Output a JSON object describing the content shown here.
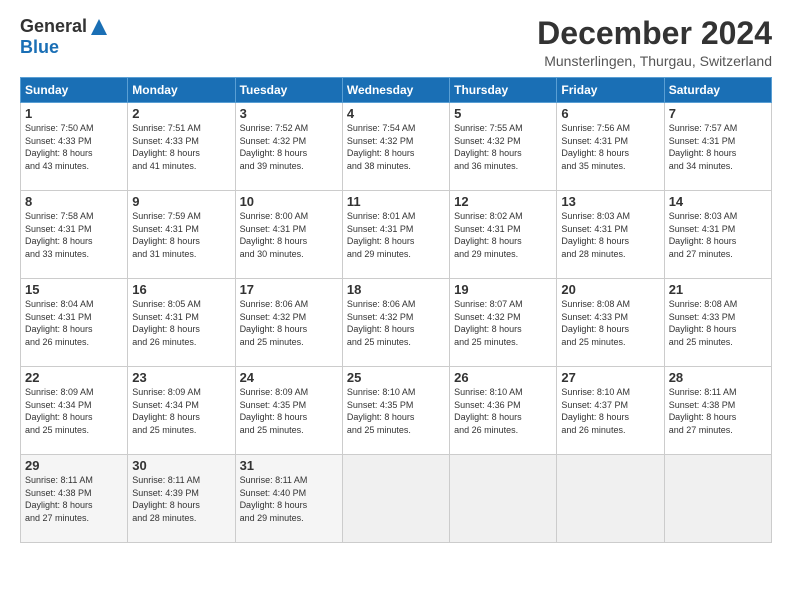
{
  "header": {
    "logo_general": "General",
    "logo_blue": "Blue",
    "month_title": "December 2024",
    "subtitle": "Munsterlingen, Thurgau, Switzerland"
  },
  "days_of_week": [
    "Sunday",
    "Monday",
    "Tuesday",
    "Wednesday",
    "Thursday",
    "Friday",
    "Saturday"
  ],
  "weeks": [
    [
      {
        "day": "1",
        "info": "Sunrise: 7:50 AM\nSunset: 4:33 PM\nDaylight: 8 hours\nand 43 minutes."
      },
      {
        "day": "2",
        "info": "Sunrise: 7:51 AM\nSunset: 4:33 PM\nDaylight: 8 hours\nand 41 minutes."
      },
      {
        "day": "3",
        "info": "Sunrise: 7:52 AM\nSunset: 4:32 PM\nDaylight: 8 hours\nand 39 minutes."
      },
      {
        "day": "4",
        "info": "Sunrise: 7:54 AM\nSunset: 4:32 PM\nDaylight: 8 hours\nand 38 minutes."
      },
      {
        "day": "5",
        "info": "Sunrise: 7:55 AM\nSunset: 4:32 PM\nDaylight: 8 hours\nand 36 minutes."
      },
      {
        "day": "6",
        "info": "Sunrise: 7:56 AM\nSunset: 4:31 PM\nDaylight: 8 hours\nand 35 minutes."
      },
      {
        "day": "7",
        "info": "Sunrise: 7:57 AM\nSunset: 4:31 PM\nDaylight: 8 hours\nand 34 minutes."
      }
    ],
    [
      {
        "day": "8",
        "info": "Sunrise: 7:58 AM\nSunset: 4:31 PM\nDaylight: 8 hours\nand 33 minutes."
      },
      {
        "day": "9",
        "info": "Sunrise: 7:59 AM\nSunset: 4:31 PM\nDaylight: 8 hours\nand 31 minutes."
      },
      {
        "day": "10",
        "info": "Sunrise: 8:00 AM\nSunset: 4:31 PM\nDaylight: 8 hours\nand 30 minutes."
      },
      {
        "day": "11",
        "info": "Sunrise: 8:01 AM\nSunset: 4:31 PM\nDaylight: 8 hours\nand 29 minutes."
      },
      {
        "day": "12",
        "info": "Sunrise: 8:02 AM\nSunset: 4:31 PM\nDaylight: 8 hours\nand 29 minutes."
      },
      {
        "day": "13",
        "info": "Sunrise: 8:03 AM\nSunset: 4:31 PM\nDaylight: 8 hours\nand 28 minutes."
      },
      {
        "day": "14",
        "info": "Sunrise: 8:03 AM\nSunset: 4:31 PM\nDaylight: 8 hours\nand 27 minutes."
      }
    ],
    [
      {
        "day": "15",
        "info": "Sunrise: 8:04 AM\nSunset: 4:31 PM\nDaylight: 8 hours\nand 26 minutes."
      },
      {
        "day": "16",
        "info": "Sunrise: 8:05 AM\nSunset: 4:31 PM\nDaylight: 8 hours\nand 26 minutes."
      },
      {
        "day": "17",
        "info": "Sunrise: 8:06 AM\nSunset: 4:32 PM\nDaylight: 8 hours\nand 25 minutes."
      },
      {
        "day": "18",
        "info": "Sunrise: 8:06 AM\nSunset: 4:32 PM\nDaylight: 8 hours\nand 25 minutes."
      },
      {
        "day": "19",
        "info": "Sunrise: 8:07 AM\nSunset: 4:32 PM\nDaylight: 8 hours\nand 25 minutes."
      },
      {
        "day": "20",
        "info": "Sunrise: 8:08 AM\nSunset: 4:33 PM\nDaylight: 8 hours\nand 25 minutes."
      },
      {
        "day": "21",
        "info": "Sunrise: 8:08 AM\nSunset: 4:33 PM\nDaylight: 8 hours\nand 25 minutes."
      }
    ],
    [
      {
        "day": "22",
        "info": "Sunrise: 8:09 AM\nSunset: 4:34 PM\nDaylight: 8 hours\nand 25 minutes."
      },
      {
        "day": "23",
        "info": "Sunrise: 8:09 AM\nSunset: 4:34 PM\nDaylight: 8 hours\nand 25 minutes."
      },
      {
        "day": "24",
        "info": "Sunrise: 8:09 AM\nSunset: 4:35 PM\nDaylight: 8 hours\nand 25 minutes."
      },
      {
        "day": "25",
        "info": "Sunrise: 8:10 AM\nSunset: 4:35 PM\nDaylight: 8 hours\nand 25 minutes."
      },
      {
        "day": "26",
        "info": "Sunrise: 8:10 AM\nSunset: 4:36 PM\nDaylight: 8 hours\nand 26 minutes."
      },
      {
        "day": "27",
        "info": "Sunrise: 8:10 AM\nSunset: 4:37 PM\nDaylight: 8 hours\nand 26 minutes."
      },
      {
        "day": "28",
        "info": "Sunrise: 8:11 AM\nSunset: 4:38 PM\nDaylight: 8 hours\nand 27 minutes."
      }
    ],
    [
      {
        "day": "29",
        "info": "Sunrise: 8:11 AM\nSunset: 4:38 PM\nDaylight: 8 hours\nand 27 minutes."
      },
      {
        "day": "30",
        "info": "Sunrise: 8:11 AM\nSunset: 4:39 PM\nDaylight: 8 hours\nand 28 minutes."
      },
      {
        "day": "31",
        "info": "Sunrise: 8:11 AM\nSunset: 4:40 PM\nDaylight: 8 hours\nand 29 minutes."
      },
      {
        "day": "",
        "info": ""
      },
      {
        "day": "",
        "info": ""
      },
      {
        "day": "",
        "info": ""
      },
      {
        "day": "",
        "info": ""
      }
    ]
  ]
}
